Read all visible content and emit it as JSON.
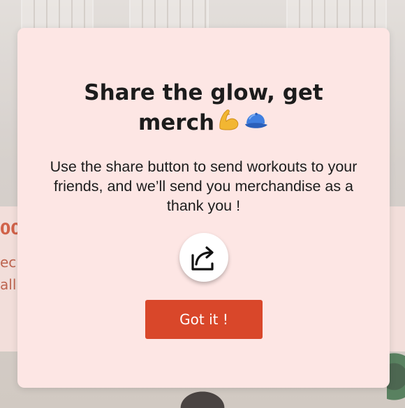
{
  "modal": {
    "title": "Share the glow, get merch",
    "title_emojis": [
      "flexed-biceps-emoji",
      "blue-cap-emoji"
    ],
    "body": "Use the share button to send workouts to your friends, and we’ll send you merchandise as a thank you !",
    "share_icon": "share-icon",
    "button_label": "Got it !"
  },
  "background": {
    "peek_heading_fragment": "00",
    "peek_line2_fragment": "ec",
    "peek_line3_fragment": "all"
  },
  "colors": {
    "modal_bg": "#fde6e4",
    "accent": "#d9472a",
    "text": "#1c1c1c"
  }
}
